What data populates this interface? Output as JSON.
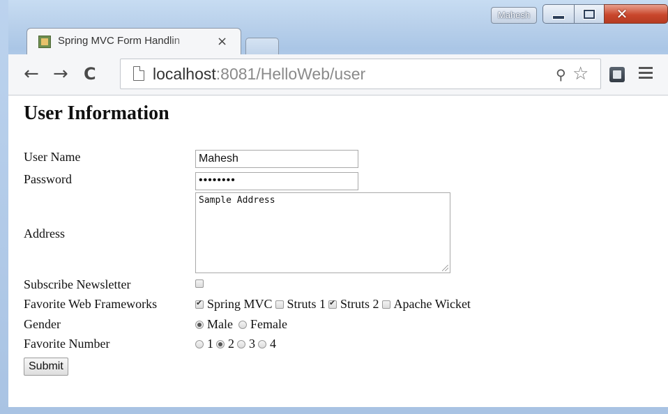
{
  "window": {
    "user_badge": "Mahesh"
  },
  "tab": {
    "title": "Spring MVC Form Handlin",
    "close_glyph": "×"
  },
  "toolbar": {
    "back_glyph": "←",
    "forward_glyph": "→",
    "reload_glyph": "C",
    "url_host": "localhost",
    "url_rest": ":8081/HelloWeb/user",
    "zoom_glyph": "⚲",
    "star_glyph": "☆"
  },
  "page": {
    "heading": "User Information",
    "fields": {
      "username_label": "User Name",
      "username_value": "Mahesh",
      "password_label": "Password",
      "password_value": "••••••••",
      "address_label": "Address",
      "address_value": "Sample Address",
      "newsletter_label": "Subscribe Newsletter",
      "newsletter_checked": false,
      "frameworks_label": "Favorite Web Frameworks",
      "frameworks": [
        {
          "label": "Spring MVC",
          "checked": true
        },
        {
          "label": "Struts 1",
          "checked": false
        },
        {
          "label": "Struts 2",
          "checked": true
        },
        {
          "label": "Apache Wicket",
          "checked": false
        }
      ],
      "gender_label": "Gender",
      "genders": [
        {
          "label": "Male",
          "checked": true
        },
        {
          "label": "Female",
          "checked": false
        }
      ],
      "number_label": "Favorite Number",
      "numbers": [
        {
          "label": "1",
          "checked": false
        },
        {
          "label": "2",
          "checked": true
        },
        {
          "label": "3",
          "checked": false
        },
        {
          "label": "4",
          "checked": false
        }
      ]
    },
    "submit_label": "Submit"
  },
  "icons": [
    "favicon-icon",
    "close-icon",
    "back-arrow-icon",
    "forward-arrow-icon",
    "reload-icon",
    "page-icon",
    "zoom-icon",
    "star-icon",
    "extension-icon",
    "menu-icon"
  ]
}
